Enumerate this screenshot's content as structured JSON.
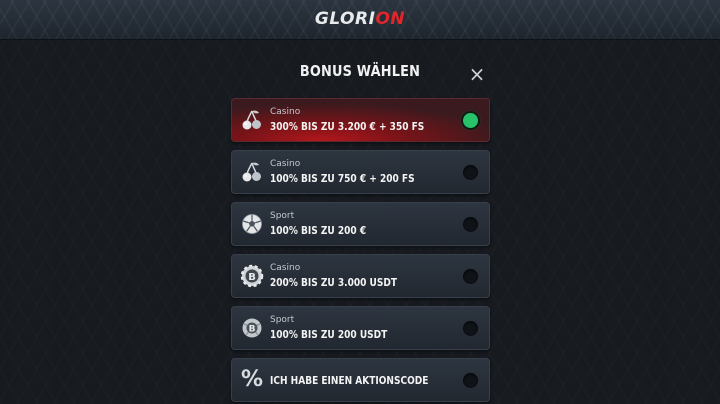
{
  "header": {
    "logo_part1": "GLORI",
    "logo_part2": "ON",
    "accent_color": "#e0262c"
  },
  "modal": {
    "title": "BONUS WÄHLEN",
    "close_icon": "×",
    "options": [
      {
        "category": "Casino",
        "label": "300% BIS ZU 3.200 € + 350 FS",
        "icon": "cherries-icon",
        "selected": true
      },
      {
        "category": "Casino",
        "label": "100% BIS ZU 750 € + 200 FS",
        "icon": "cherries-icon",
        "selected": false
      },
      {
        "category": "Sport",
        "label": "100% BIS ZU 200 €",
        "icon": "soccer-ball-icon",
        "selected": false
      },
      {
        "category": "Casino",
        "label": "200% BIS ZU 3.000 USDT",
        "icon": "bitcoin-chip-icon",
        "selected": false
      },
      {
        "category": "Sport",
        "label": "100% BIS ZU 200 USDT",
        "icon": "bitcoin-ball-icon",
        "selected": false
      },
      {
        "category": "",
        "label": "ICH HABE EINEN AKTIONSCODE",
        "icon": "percent-icon",
        "icon_glyph": "%",
        "selected": false
      }
    ],
    "selected_color": "#27c26a"
  }
}
